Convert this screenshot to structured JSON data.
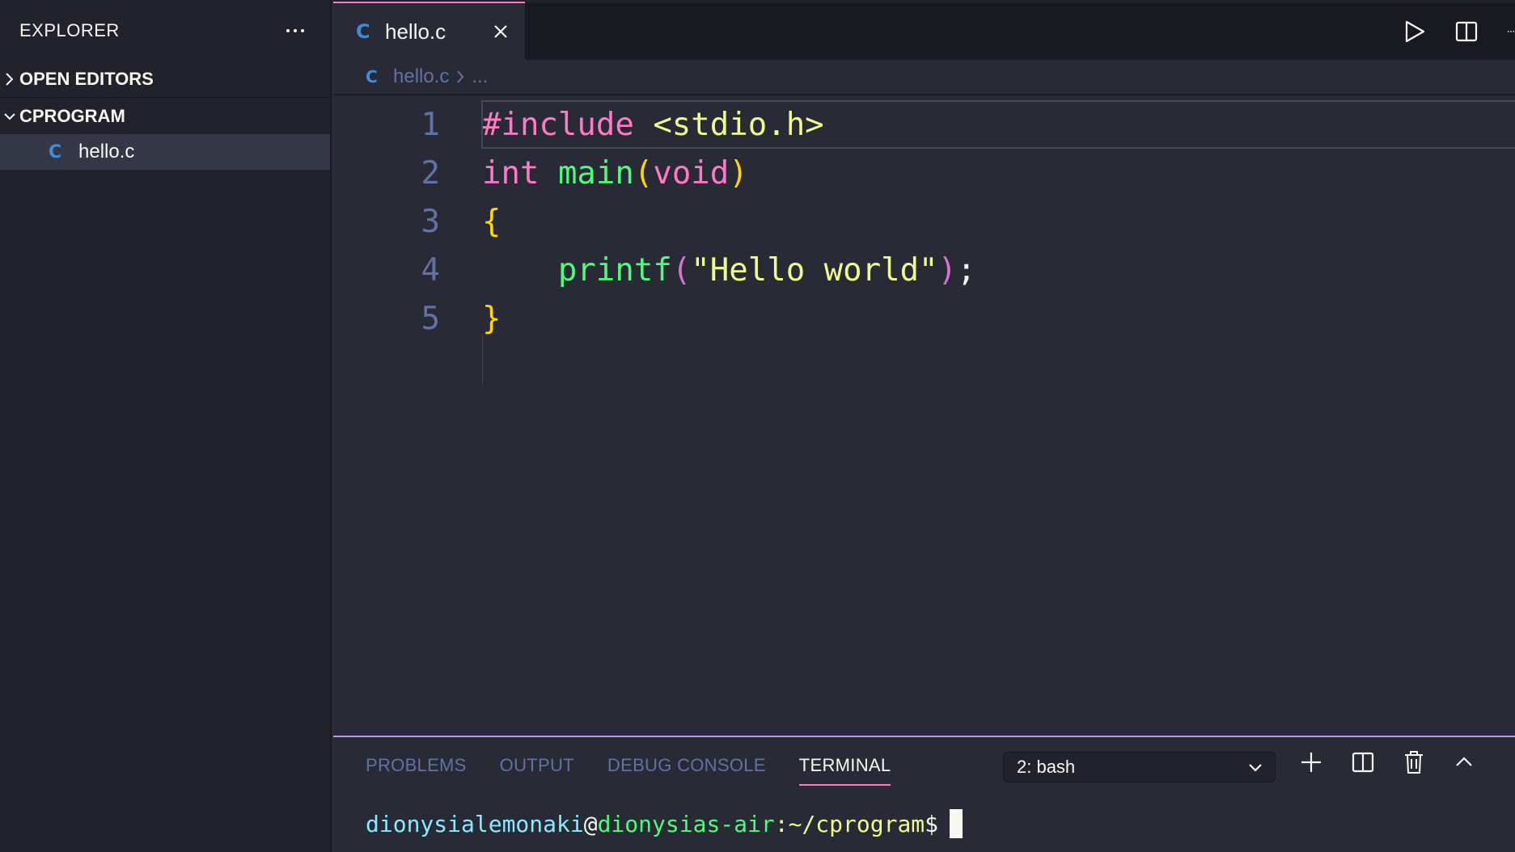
{
  "sidebar": {
    "title": "EXPLORER",
    "sections": {
      "open_editors": "OPEN EDITORS",
      "project": "CPROGRAM"
    },
    "files": [
      {
        "name": "hello.c",
        "icon": "C"
      }
    ]
  },
  "tab": {
    "icon": "C",
    "label": "hello.c"
  },
  "breadcrumb": {
    "icon": "C",
    "file": "hello.c",
    "more": "..."
  },
  "editor": {
    "line_numbers": [
      "1",
      "2",
      "3",
      "4",
      "5"
    ],
    "line1": {
      "directive": "#include",
      "header": "<stdio.h>"
    },
    "line2": {
      "type": "int",
      "func": "main",
      "lparen": "(",
      "param": "void",
      "rparen": ")"
    },
    "line3": {
      "brace": "{"
    },
    "line4": {
      "indent": "    ",
      "func": "printf",
      "lparen": "(",
      "string": "\"Hello world\"",
      "rparen": ")",
      "semi": ";"
    },
    "line5": {
      "brace": "}"
    }
  },
  "panel": {
    "tabs": [
      "PROBLEMS",
      "OUTPUT",
      "DEBUG CONSOLE",
      "TERMINAL"
    ],
    "active_tab": "TERMINAL",
    "terminal_select": "2: bash"
  },
  "terminal": {
    "user": "dionysialemonaki",
    "at": "@",
    "host": "dionysias-air",
    "path": ":~/cprogram",
    "prompt": "$"
  },
  "theme": {
    "accent": "#ff79c6",
    "background": "#282a36",
    "sidebar": "#21222c",
    "c_icon": "#3c8dde"
  }
}
